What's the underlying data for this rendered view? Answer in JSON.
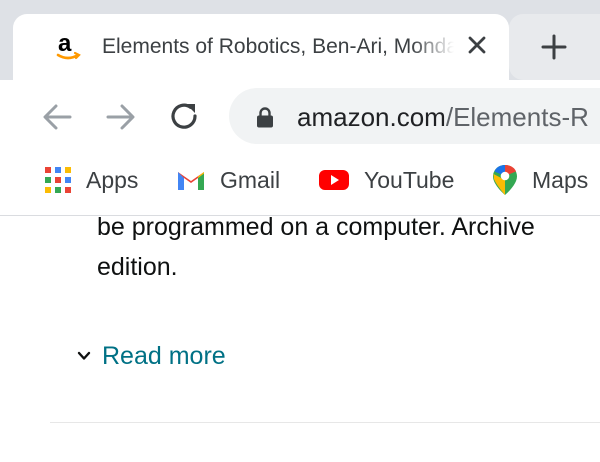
{
  "tab": {
    "title": "Elements of Robotics, Ben-Ari, Mondada"
  },
  "toolbar": {
    "url_host": "amazon.com",
    "url_path": "/Elements-R"
  },
  "bookmarks": [
    {
      "label": "Apps",
      "icon": "apps-grid-icon"
    },
    {
      "label": "Gmail",
      "icon": "gmail-icon"
    },
    {
      "label": "YouTube",
      "icon": "youtube-icon"
    },
    {
      "label": "Maps",
      "icon": "maps-pin-icon"
    }
  ],
  "product": {
    "description_lines": [
      "be programmed on a computer. Archive",
      "edition."
    ],
    "read_more_label": "Read more"
  },
  "colors": {
    "link": "#007185",
    "tabstrip": "#dee1e6",
    "omnibox": "#f1f3f4"
  }
}
